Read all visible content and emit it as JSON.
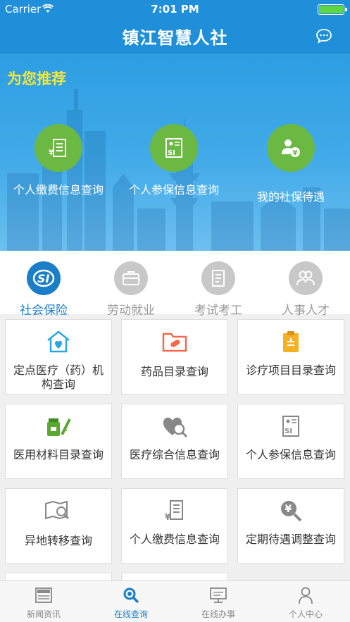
{
  "status_bar": {
    "carrier": "Carrier",
    "time": "7:01 PM"
  },
  "nav": {
    "title": "镇江智慧人社",
    "icon": "chat-bubble-icon"
  },
  "recommend": {
    "title": "为您推荐",
    "items": [
      {
        "label": "个人缴费信息查询",
        "icon": "payment-record-icon"
      },
      {
        "label": "个人参保信息查询",
        "icon": "si-card-icon"
      },
      {
        "label": "我的社保待遇",
        "icon": "user-yuan-icon"
      }
    ]
  },
  "categories": [
    {
      "label": "社会保险",
      "icon": "si-logo-icon",
      "active": true
    },
    {
      "label": "劳动就业",
      "icon": "briefcase-icon",
      "active": false
    },
    {
      "label": "考试考工",
      "icon": "exam-icon",
      "active": false
    },
    {
      "label": "人事人才",
      "icon": "people-icon",
      "active": false
    }
  ],
  "services": [
    {
      "label": "定点医疗（药）机构查询",
      "icon": "medical-house-icon"
    },
    {
      "label": "药品目录查询",
      "icon": "medicine-folder-icon"
    },
    {
      "label": "诊疗项目目录查询",
      "icon": "clipboard-icon"
    },
    {
      "label": "医用材料目录查询",
      "icon": "medical-supplies-icon"
    },
    {
      "label": "医疗综合信息查询",
      "icon": "heart-search-icon"
    },
    {
      "label": "个人参保信息查询",
      "icon": "si-card-icon"
    },
    {
      "label": "异地转移查询",
      "icon": "map-search-icon"
    },
    {
      "label": "个人缴费信息查询",
      "icon": "payment-record-icon"
    },
    {
      "label": "定期待遇调整查询",
      "icon": "yuan-search-icon"
    }
  ],
  "tabs": [
    {
      "label": "新闻资讯",
      "icon": "news-icon",
      "active": false
    },
    {
      "label": "在线查询",
      "icon": "search-icon",
      "active": true
    },
    {
      "label": "在线办事",
      "icon": "monitor-icon",
      "active": false
    },
    {
      "label": "个人中心",
      "icon": "person-icon",
      "active": false
    }
  ],
  "colors": {
    "primary_blue": "#1e8fd8",
    "recommend_title": "#f3e53b",
    "recommend_icon_bg": "#6bb843",
    "active_tab": "#1a7fc8"
  }
}
